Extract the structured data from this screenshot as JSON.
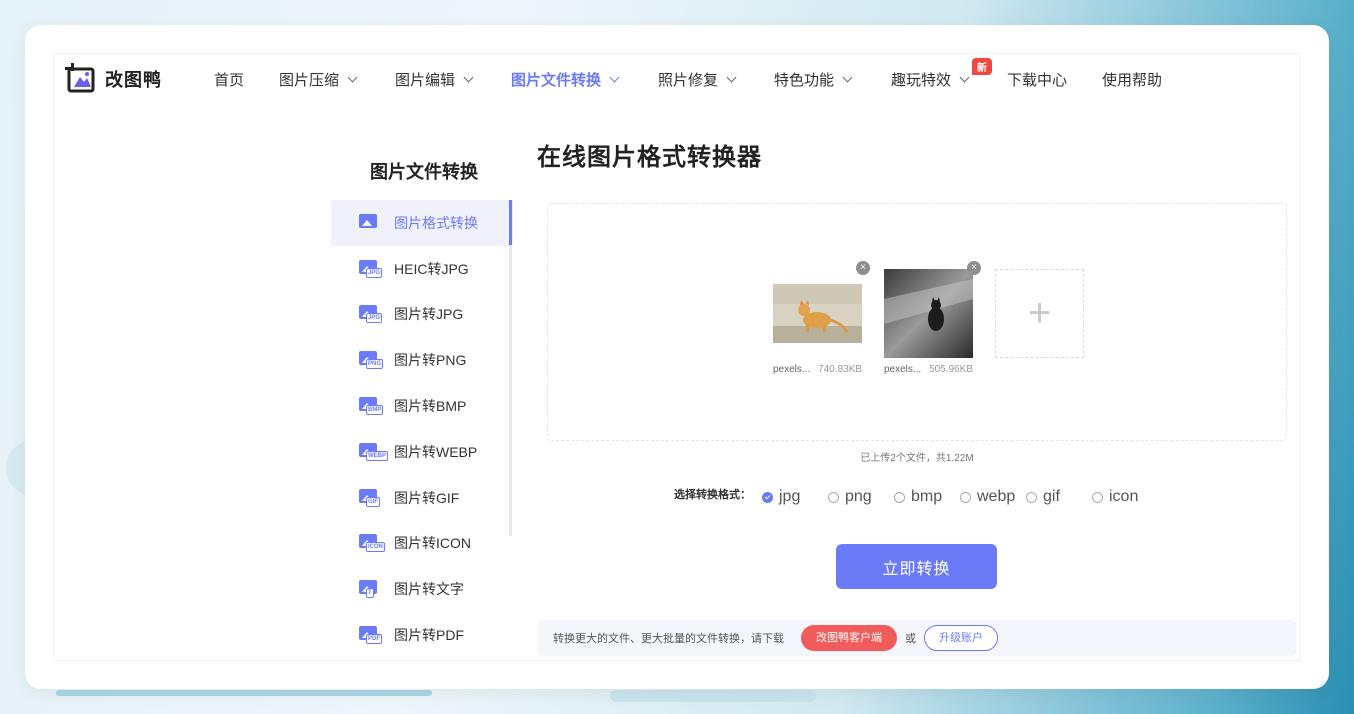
{
  "brand": {
    "name": "改图鸭",
    "accent": "#6b7bf7"
  },
  "nav": {
    "items": [
      {
        "label": "首页",
        "has_menu": false,
        "active": false
      },
      {
        "label": "图片压缩",
        "has_menu": true,
        "active": false
      },
      {
        "label": "图片编辑",
        "has_menu": true,
        "active": false
      },
      {
        "label": "图片文件转换",
        "has_menu": true,
        "active": true
      },
      {
        "label": "照片修复",
        "has_menu": true,
        "active": false
      },
      {
        "label": "特色功能",
        "has_menu": true,
        "active": false
      },
      {
        "label": "趣玩特效",
        "has_menu": true,
        "active": false,
        "badge": "新"
      },
      {
        "label": "下载中心",
        "has_menu": false,
        "active": false
      },
      {
        "label": "使用帮助",
        "has_menu": false,
        "active": false
      }
    ]
  },
  "sidebar": {
    "title": "图片文件转换",
    "items": [
      {
        "label": "图片格式转换",
        "icon": "image-convert-icon",
        "tag": "",
        "active": true
      },
      {
        "label": "HEIC转JPG",
        "icon": "heic-jpg-icon",
        "tag": "JPG",
        "active": false
      },
      {
        "label": "图片转JPG",
        "icon": "image-jpg-icon",
        "tag": "JPG",
        "active": false
      },
      {
        "label": "图片转PNG",
        "icon": "image-png-icon",
        "tag": "PNG",
        "active": false
      },
      {
        "label": "图片转BMP",
        "icon": "image-bmp-icon",
        "tag": "BMP",
        "active": false
      },
      {
        "label": "图片转WEBP",
        "icon": "image-webp-icon",
        "tag": "WEBP",
        "active": false
      },
      {
        "label": "图片转GIF",
        "icon": "image-gif-icon",
        "tag": "GIF",
        "active": false
      },
      {
        "label": "图片转ICON",
        "icon": "image-icon-icon",
        "tag": "ICON",
        "active": false
      },
      {
        "label": "图片转文字",
        "icon": "image-text-icon",
        "tag": "T",
        "active": false
      },
      {
        "label": "图片转PDF",
        "icon": "image-pdf-icon",
        "tag": "PDF",
        "active": false
      }
    ]
  },
  "main": {
    "title": "在线图片格式转换器",
    "files": [
      {
        "name": "pexels...",
        "size": "740.83KB"
      },
      {
        "name": "pexels...",
        "size": "505.96KB"
      }
    ],
    "add_symbol": "+",
    "upload_info": "已上传2个文件，共1.22M",
    "format_label": "选择转换格式：",
    "formats": [
      {
        "label": "jpg",
        "selected": true
      },
      {
        "label": "png",
        "selected": false
      },
      {
        "label": "bmp",
        "selected": false
      },
      {
        "label": "webp",
        "selected": false
      },
      {
        "label": "gif",
        "selected": false
      },
      {
        "label": "icon",
        "selected": false
      }
    ],
    "convert_label": "立即转换"
  },
  "bottom": {
    "text": "转换更大的文件、更大批量的文件转换，请下载",
    "client_label": "改图鸭客户端",
    "or_text": "或",
    "upgrade_label": "升级账户"
  }
}
